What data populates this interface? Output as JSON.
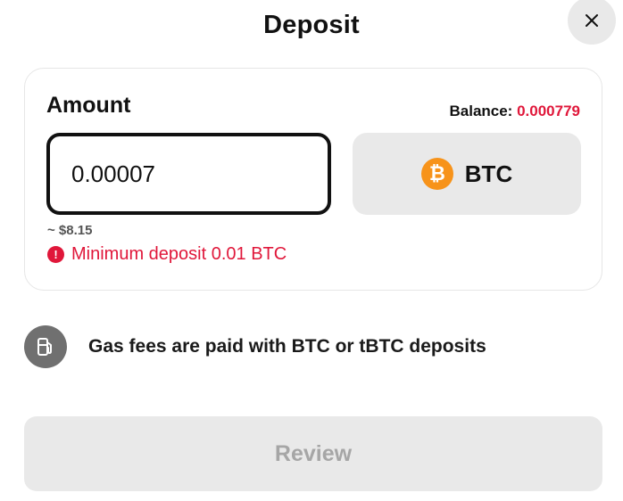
{
  "title": "Deposit",
  "close": {
    "icon": "close-icon"
  },
  "amount": {
    "label": "Amount",
    "balance_label": "Balance:",
    "balance_value": "0.000779",
    "input_value": "0.00007",
    "usd_value": "~ $8.15",
    "error": "Minimum deposit 0.01 BTC"
  },
  "token": {
    "symbol": "BTC",
    "icon_glyph": "₿",
    "icon": "bitcoin-icon"
  },
  "gas": {
    "text": "Gas fees are paid with BTC or tBTC deposits",
    "icon": "gas-pump-icon"
  },
  "review": {
    "label": "Review"
  },
  "colors": {
    "error": "#e0173a",
    "bitcoin": "#f7931a",
    "disabled_bg": "#e9e9e9",
    "disabled_text": "#a6a6a6"
  }
}
